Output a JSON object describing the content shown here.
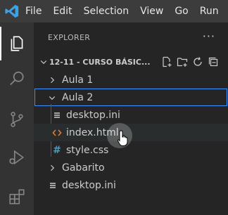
{
  "titlebar": {
    "menu": [
      "File",
      "Edit",
      "Selection",
      "View",
      "Go",
      "Run"
    ]
  },
  "activity_bar": {
    "items": [
      "explorer-icon",
      "search-icon",
      "source-control-icon",
      "run-debug-icon",
      "extensions-icon"
    ],
    "active": "explorer-icon"
  },
  "explorer": {
    "title": "EXPLORER",
    "more": "···",
    "folder": {
      "title": "12-11 - CURSO BÁSIC...",
      "actions": [
        "new-file-icon",
        "new-folder-icon",
        "refresh-icon",
        "collapse-all-icon"
      ]
    },
    "tree": [
      {
        "label": "Aula 1",
        "type": "folder",
        "expanded": false,
        "depth": 1
      },
      {
        "label": "Aula 2",
        "type": "folder",
        "expanded": true,
        "depth": 1,
        "focused": true
      },
      {
        "label": "desktop.ini",
        "type": "file",
        "icon": "ini-file-icon",
        "depth": 2
      },
      {
        "label": "index.html",
        "type": "file",
        "icon": "html-file-icon",
        "depth": 2,
        "hovered": true
      },
      {
        "label": "style.css",
        "type": "file",
        "icon": "css-file-icon",
        "depth": 2
      },
      {
        "label": "Gabarito",
        "type": "folder",
        "expanded": false,
        "depth": 1
      },
      {
        "label": "desktop.ini",
        "type": "file",
        "icon": "ini-file-icon",
        "depth": 1
      }
    ]
  },
  "colors": {
    "accent": "#3794ff",
    "vscode_blue": "#3ba4e8",
    "html_icon": "#e37933",
    "css_icon": "#519aba",
    "titlebar_bg": "#3c3c3c",
    "activity_bg": "#333333",
    "sidebar_bg": "#252526"
  }
}
